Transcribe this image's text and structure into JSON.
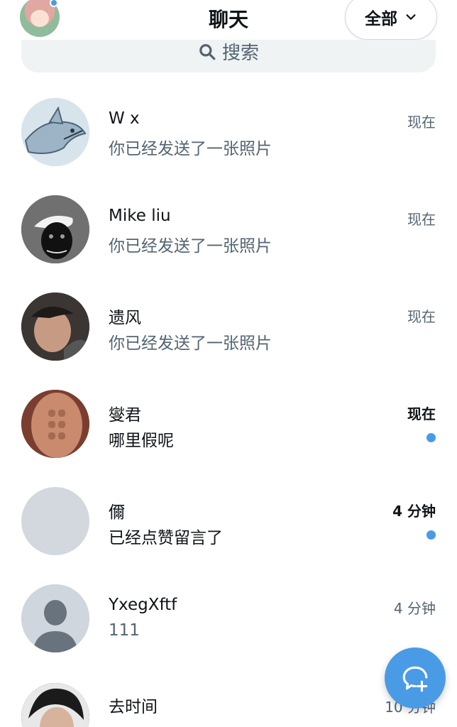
{
  "header": {
    "title": "聊天",
    "filter_label": "全部",
    "profile_icon": "user-avatar",
    "filter_icon": "chevron-down-icon"
  },
  "search": {
    "placeholder": "搜索",
    "icon": "search-icon"
  },
  "chats": [
    {
      "name": "W x",
      "preview": "你已经发送了一张照片",
      "time": "现在",
      "unread": false,
      "avatar": "shark-cartoon"
    },
    {
      "name": "Mike liu",
      "preview": "你已经发送了一张照片",
      "time": "现在",
      "unread": false,
      "avatar": "black-cat-cap"
    },
    {
      "name": "遗风",
      "preview": "你已经发送了一张照片",
      "time": "现在",
      "unread": false,
      "avatar": "person-photo"
    },
    {
      "name": "燮君",
      "preview": "哪里假呢",
      "time": "现在",
      "unread": true,
      "avatar": "torso-photo"
    },
    {
      "name": "儞",
      "preview": "已经点赞留言了",
      "time": "4 分钟",
      "unread": true,
      "avatar": "blank-gray"
    },
    {
      "name": "YxegXftf",
      "preview": "111",
      "time": "4 分钟",
      "unread": false,
      "avatar": "default-user"
    },
    {
      "name": "去时间",
      "preview": "",
      "time": "10 分钟",
      "unread": false,
      "avatar": "person-photo-2"
    }
  ],
  "compose": {
    "icon": "new-message-icon"
  },
  "colors": {
    "accent": "#4a9be6",
    "text_primary": "#0f1419",
    "text_secondary": "#536471",
    "search_bg": "#eff3f4"
  }
}
